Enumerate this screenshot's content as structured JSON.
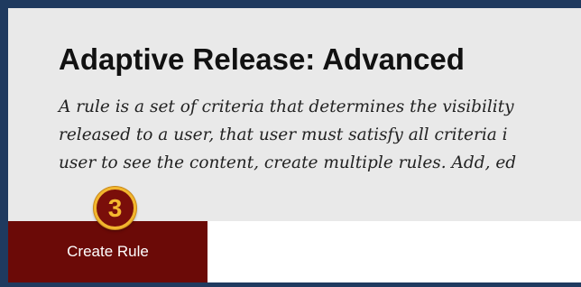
{
  "page": {
    "title": "Adaptive Release: Advanced",
    "description_lines": [
      "A rule is a set of criteria that determines the visibility",
      "released to a user, that user must satisfy all criteria i",
      "user to see the content, create multiple rules. Add, ed"
    ]
  },
  "annotation": {
    "step_number": "3"
  },
  "actions": {
    "create_rule_label": "Create Rule"
  },
  "colors": {
    "frame_border": "#1f3a5f",
    "header_background": "#e9e9e9",
    "button_background": "#6b0a07",
    "badge_ring": "#f2b62e"
  }
}
